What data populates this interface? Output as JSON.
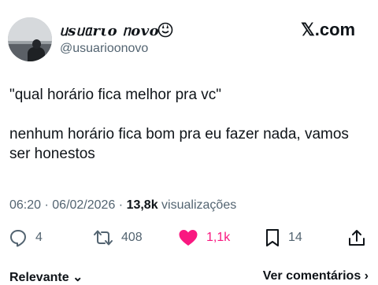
{
  "author": {
    "display_name": "ᥙsᥙᥲrιo ᥒovo",
    "handle": "@usuarioonovo",
    "emoji_icon": "smiley-peace-icon"
  },
  "brand": {
    "label": "𝕏.com"
  },
  "tweet": {
    "line1": "\"qual horário fica melhor pra vc\"",
    "line2": "nenhum horário fica bom pra eu fazer nada, vamos ser honestos"
  },
  "meta": {
    "time": "06:20",
    "separator1": " · ",
    "date": "06/02/2026",
    "separator2": " · ",
    "views_count": "13,8k",
    "views_label": " visualizações"
  },
  "actions": {
    "replies": "4",
    "reposts": "408",
    "likes": "1,1k",
    "bookmarks": "14"
  },
  "colors": {
    "like": "#f91880",
    "secondary_text": "#536471",
    "primary_text": "#0f1419"
  },
  "footer": {
    "left": "Relevante ⌄",
    "right": "Ver comentários ›"
  }
}
